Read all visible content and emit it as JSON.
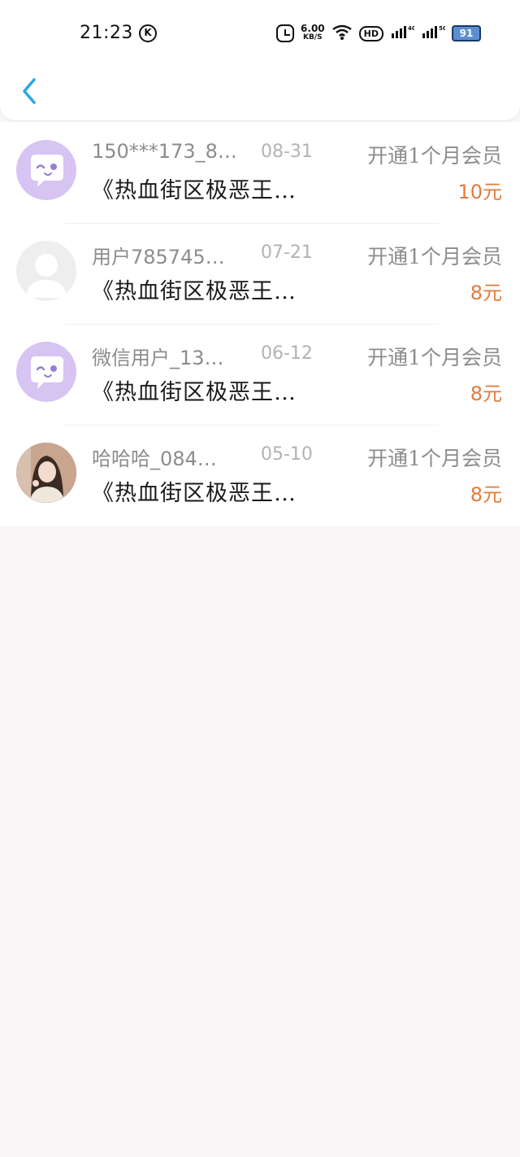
{
  "status_bar": {
    "time": "21:23",
    "speed_value": "6.00",
    "speed_unit": "KB/S",
    "hd_label": "HD",
    "battery": "91",
    "icons": [
      "alarm-icon",
      "network-speed",
      "wifi-icon",
      "hd-icon",
      "signal-4g-icon",
      "signal-5g-icon",
      "battery-icon"
    ]
  },
  "header": {
    "back_icon": "chevron-left-icon",
    "accent": "#2aa6e6"
  },
  "records": [
    {
      "username": "150***173_8…",
      "date": "08-31",
      "action": "开通1个月会员",
      "book": "《热血街区极恶王…",
      "amount": "10元",
      "avatar": "chat-bubble"
    },
    {
      "username": "用户785745…",
      "date": "07-21",
      "action": "开通1个月会员",
      "book": "《热血街区极恶王…",
      "amount": "8元",
      "avatar": "default-person"
    },
    {
      "username": "微信用户_13…",
      "date": "06-12",
      "action": "开通1个月会员",
      "book": "《热血街区极恶王…",
      "amount": "8元",
      "avatar": "chat-bubble"
    },
    {
      "username": "哈哈哈_084…",
      "date": "05-10",
      "action": "开通1个月会员",
      "book": "《热血街区极恶王…",
      "amount": "8元",
      "avatar": "user-photo"
    }
  ],
  "colors": {
    "amount": "#e07b3d",
    "avatar_purple": "#d7c4f2",
    "page_bg": "#f8f6f7"
  }
}
